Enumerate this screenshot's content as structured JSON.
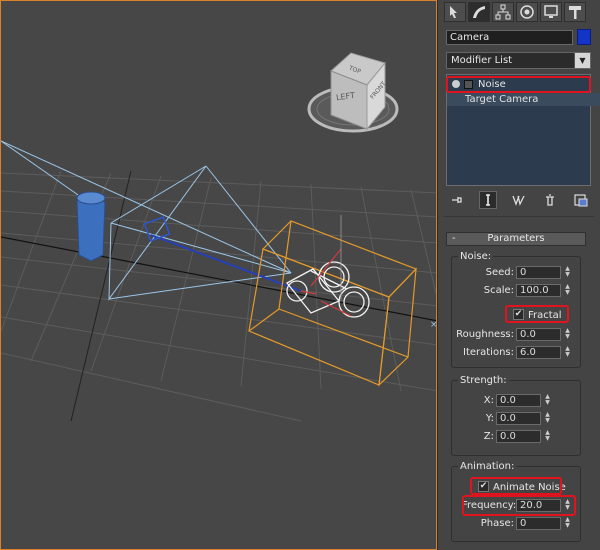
{
  "panel": {
    "tabs": [
      "create-tab",
      "modify-tab",
      "hierarchy-tab",
      "motion-tab",
      "display-tab",
      "utilities-tab"
    ],
    "object_name": "Camera",
    "object_color": "#1434c8",
    "modifier_list": "Modifier List",
    "stack": {
      "noise_label": "Noise",
      "target_camera_label": "Target Camera"
    },
    "parameters": {
      "rollout_title": "Parameters",
      "rollout_toggle": "-",
      "noise_group": {
        "title": "Noise:",
        "seed_label": "Seed:",
        "seed_value": "0",
        "scale_label": "Scale:",
        "scale_value": "100.0",
        "fractal_label": "Fractal",
        "fractal_checked": "✔",
        "roughness_label": "Roughness:",
        "roughness_value": "0.0",
        "iterations_label": "Iterations:",
        "iterations_value": "6.0"
      },
      "strength_group": {
        "title": "Strength:",
        "x_label": "X:",
        "x_value": "0.0",
        "y_label": "Y:",
        "y_value": "0.0",
        "z_label": "Z:",
        "z_value": "0.0"
      },
      "animation_group": {
        "title": "Animation:",
        "animate_noise_label": "Animate Noise",
        "animate_noise_checked": "✔",
        "frequency_label": "Frequency:",
        "frequency_value": "20.0",
        "phase_label": "Phase:",
        "phase_value": "0"
      }
    }
  },
  "viewport": {
    "viewcube": {
      "left_label": "LEFT",
      "front_label": "FRONT",
      "top_label": "TOP"
    }
  },
  "colors": {
    "highlight_red": "#e0141e",
    "selection_orange": "#e39a2a",
    "frustum_blue": "#9cc6e8"
  }
}
